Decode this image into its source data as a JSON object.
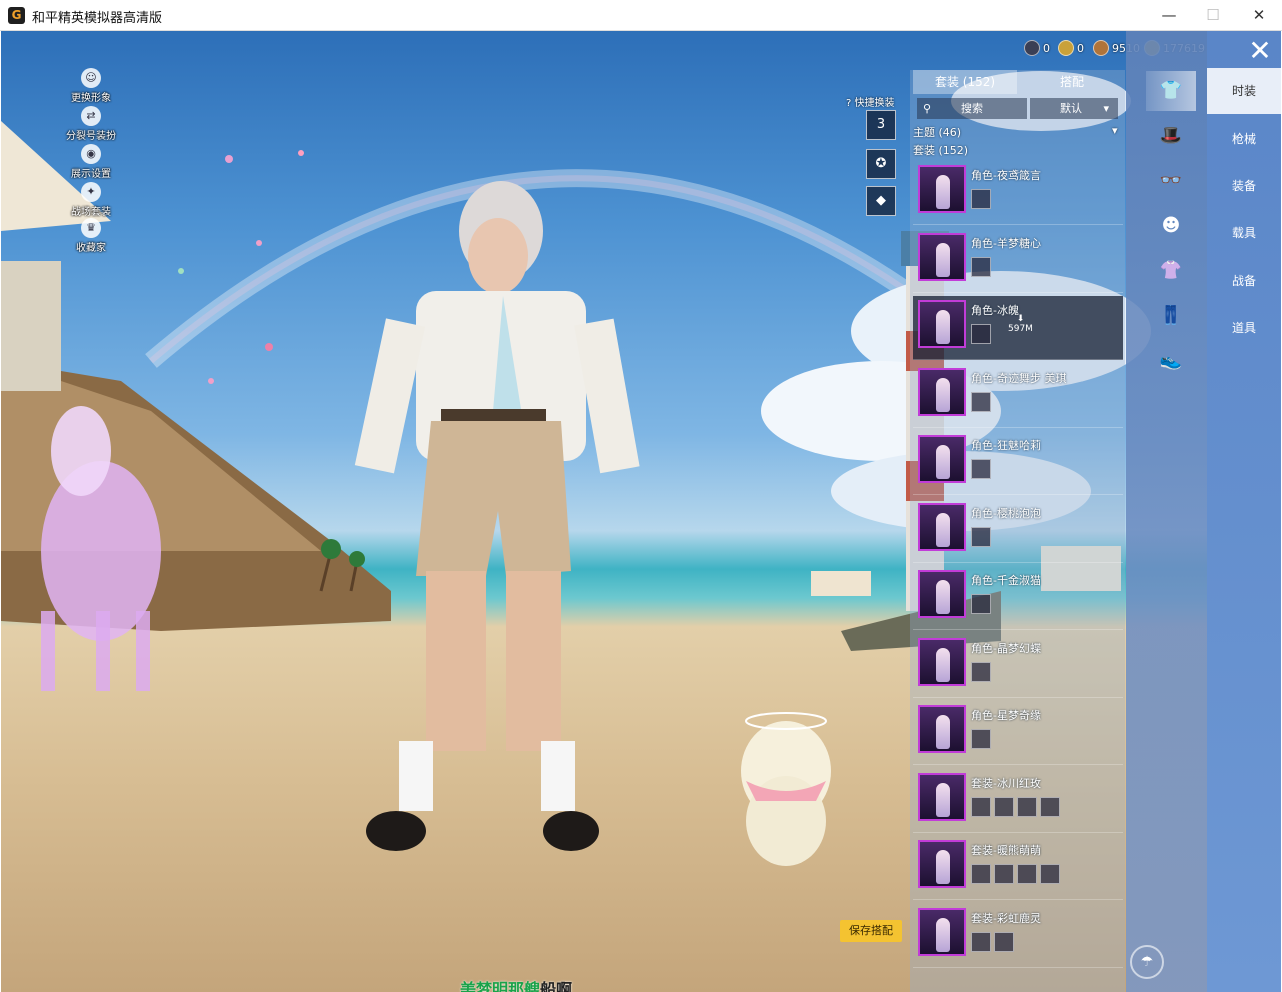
{
  "window": {
    "icon_glyph": "G",
    "title": "和平精英模拟器高清版",
    "min_glyph": "—",
    "max_glyph": "☐",
    "close_glyph": "✕"
  },
  "left_shortcuts": [
    {
      "label": "更换形象",
      "icon": "avatar-icon",
      "glyph": "☺"
    },
    {
      "label": "分裂号装扮",
      "icon": "swap-icon",
      "glyph": "⇄"
    },
    {
      "label": "展示设置",
      "icon": "eye-icon",
      "glyph": "◉"
    },
    {
      "label": "战场套装",
      "icon": "outfit-icon",
      "glyph": "✦"
    },
    {
      "label": "收藏家",
      "icon": "collector-icon",
      "glyph": "♛"
    }
  ],
  "currency": [
    {
      "icon": "token-icon",
      "value": "0",
      "color": "#3a3f55"
    },
    {
      "icon": "a-coin-icon",
      "value": "0",
      "color": "#c9a13a"
    },
    {
      "icon": "bp-coin-icon",
      "value": "9510",
      "color": "#b0743a"
    },
    {
      "icon": "gold-coin-icon",
      "value": "177619",
      "color": "#e0b43a"
    }
  ],
  "quick_change": {
    "label": "快捷换装",
    "help_glyph": "?",
    "buttons": [
      {
        "icon": "wardrobe-icon",
        "glyph": "3"
      },
      {
        "icon": "emblem-icon",
        "glyph": "✪"
      },
      {
        "icon": "diamond-icon",
        "glyph": "◆"
      }
    ]
  },
  "list_panel": {
    "tabs": [
      {
        "label": "套装 (152)",
        "active": true
      },
      {
        "label": "搭配",
        "active": false
      }
    ],
    "search_label": "搜索",
    "sort_label": "默认",
    "sort_arrow": "▾",
    "theme_label": "主题 (46)",
    "theme_arrow": "▾",
    "set_label": "套装 (152)",
    "items": [
      {
        "name": "角色-夜鸢箴言",
        "subs": 1,
        "selected": false
      },
      {
        "name": "角色-羊梦糖心",
        "subs": 1,
        "selected": false
      },
      {
        "name": "角色-冰魄",
        "subs": 1,
        "selected": true,
        "download": "597M"
      },
      {
        "name": "角色-奇迹舞步 美琪",
        "subs": 1,
        "selected": false
      },
      {
        "name": "角色-狂魅哈莉",
        "subs": 1,
        "selected": false
      },
      {
        "name": "角色-樱桃泡泡",
        "subs": 1,
        "selected": false
      },
      {
        "name": "角色-千金淑猫",
        "subs": 1,
        "selected": false
      },
      {
        "name": "角色-晶梦幻蝶",
        "subs": 1,
        "selected": false
      },
      {
        "name": "角色-星梦奇缘",
        "subs": 1,
        "selected": false
      },
      {
        "name": "套装-冰川红玫",
        "subs": 4,
        "selected": false
      },
      {
        "name": "套装-暖熊萌萌",
        "subs": 4,
        "selected": false
      },
      {
        "name": "套装-彩虹鹿灵",
        "subs": 2,
        "selected": false
      }
    ]
  },
  "category_icons": [
    {
      "icon": "outfit-category-icon",
      "glyph": "👕"
    },
    {
      "icon": "hat-icon",
      "glyph": "🎩"
    },
    {
      "icon": "glasses-icon",
      "glyph": "👓"
    },
    {
      "icon": "mask-icon",
      "glyph": "☻"
    },
    {
      "icon": "top-icon",
      "glyph": "👚"
    },
    {
      "icon": "pants-icon",
      "glyph": "👖"
    },
    {
      "icon": "shoes-icon",
      "glyph": "👟"
    }
  ],
  "main_menu": [
    {
      "label": "时装",
      "active": true
    },
    {
      "label": "枪械",
      "active": false
    },
    {
      "label": "装备",
      "active": false
    },
    {
      "label": "载具",
      "active": false
    },
    {
      "label": "战备",
      "active": false
    },
    {
      "label": "道具",
      "active": false
    }
  ],
  "close_glyph": "✕",
  "save_button": "保存搭配",
  "parachute_glyph": "☂",
  "bottom_text": {
    "green": "美梦明那艘",
    "dark": "船啊"
  }
}
